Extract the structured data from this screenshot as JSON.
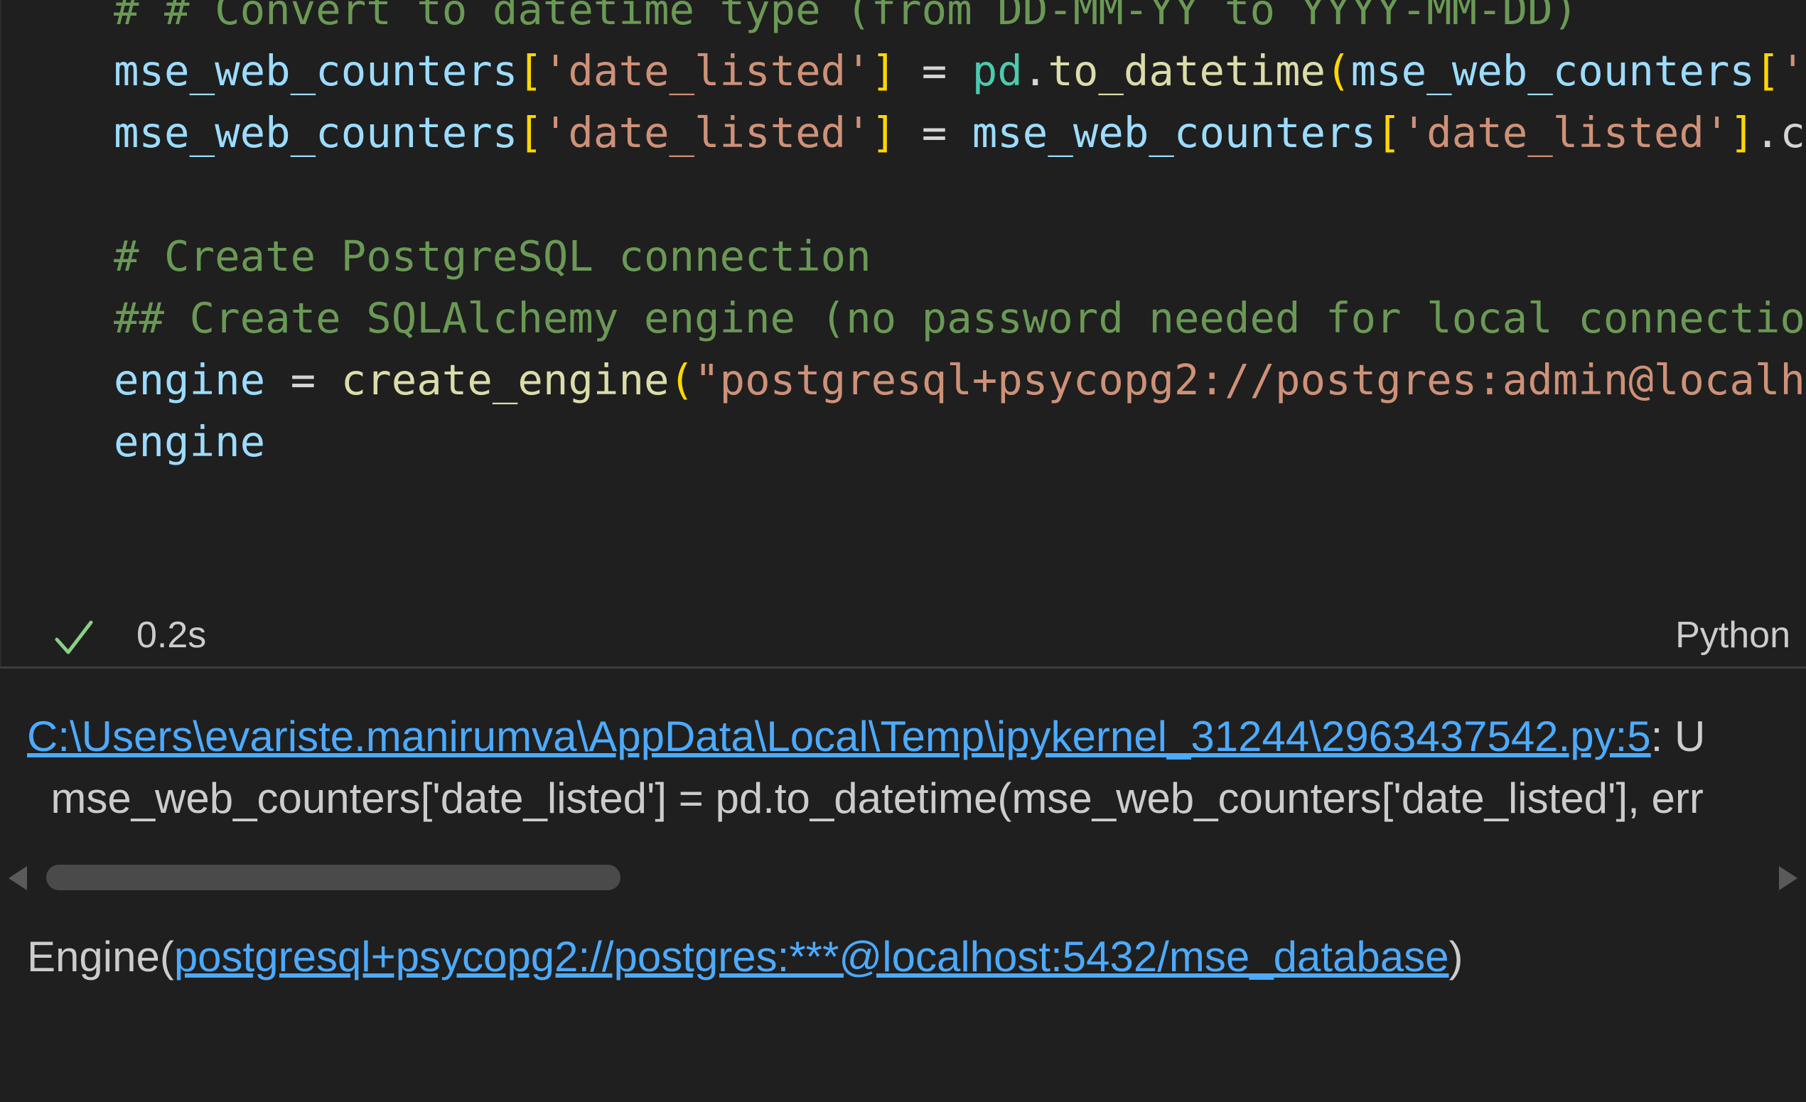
{
  "code_lines": [
    {
      "tokens": [
        {
          "t": "# # Convert to datetime type (from DD-MM-YY to YYYY-MM-DD)",
          "c": "comment"
        }
      ]
    },
    {
      "tokens": [
        {
          "t": "mse_web_counters",
          "c": "var"
        },
        {
          "t": "[",
          "c": "br"
        },
        {
          "t": "'date_listed'",
          "c": "str"
        },
        {
          "t": "]",
          "c": "br"
        },
        {
          "t": " = ",
          "c": "op"
        },
        {
          "t": "pd",
          "c": "mod"
        },
        {
          "t": ".",
          "c": "op"
        },
        {
          "t": "to_datetime",
          "c": "fn"
        },
        {
          "t": "(",
          "c": "br"
        },
        {
          "t": "mse_web_counters",
          "c": "var"
        },
        {
          "t": "[",
          "c": "br"
        },
        {
          "t": "'",
          "c": "str"
        }
      ]
    },
    {
      "tokens": [
        {
          "t": "mse_web_counters",
          "c": "var"
        },
        {
          "t": "[",
          "c": "br"
        },
        {
          "t": "'date_listed'",
          "c": "str"
        },
        {
          "t": "]",
          "c": "br"
        },
        {
          "t": " = ",
          "c": "op"
        },
        {
          "t": "mse_web_counters",
          "c": "var"
        },
        {
          "t": "[",
          "c": "br"
        },
        {
          "t": "'date_listed'",
          "c": "str"
        },
        {
          "t": "]",
          "c": "br"
        },
        {
          "t": ".c",
          "c": "op"
        }
      ]
    },
    {
      "tokens": []
    },
    {
      "tokens": [
        {
          "t": "# Create PostgreSQL connection",
          "c": "comment"
        }
      ]
    },
    {
      "tokens": [
        {
          "t": "## Create SQLAlchemy engine (no password needed for local connectio",
          "c": "comment"
        }
      ]
    },
    {
      "tokens": [
        {
          "t": "engine",
          "c": "var"
        },
        {
          "t": " = ",
          "c": "op"
        },
        {
          "t": "create_engine",
          "c": "fn"
        },
        {
          "t": "(",
          "c": "br"
        },
        {
          "t": "\"postgresql+psycopg2://postgres:admin@localh",
          "c": "str"
        }
      ]
    },
    {
      "tokens": [
        {
          "t": "engine",
          "c": "var"
        }
      ]
    }
  ],
  "cell_status": {
    "elapsed": "0.2s",
    "language": "Python"
  },
  "output": {
    "warning_path": "C:\\Users\\evariste.manirumva\\AppData\\Local\\Temp\\ipykernel_31244\\2963437542.py:5",
    "warning_suffix": ": U",
    "warning_source": "  mse_web_counters['date_listed'] = pd.to_datetime(mse_web_counters['date_listed'], err",
    "engine_prefix": "Engine(",
    "engine_url": "postgresql+psycopg2://postgres:***@localhost:5432/mse_database",
    "engine_suffix": ")"
  },
  "colors": {
    "background": "#1f1f1f",
    "comment": "#6a9955",
    "variable": "#9cdcfe",
    "module": "#4ec9b0",
    "function": "#dcdcaa",
    "string": "#ce9178",
    "bracket": "#ffd700",
    "link": "#4daafc",
    "success": "#89d185"
  }
}
